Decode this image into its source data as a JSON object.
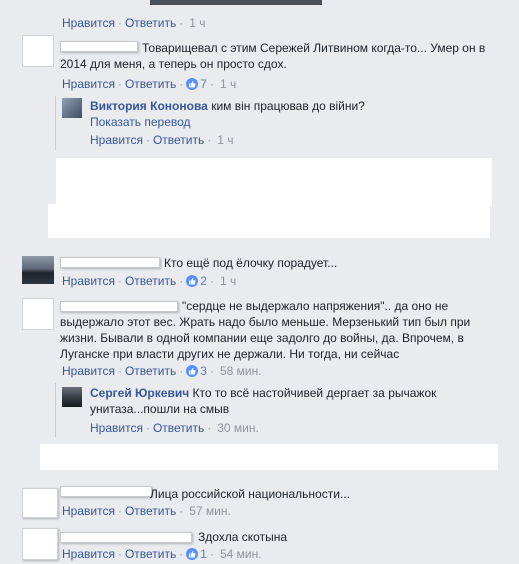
{
  "colors": {
    "page_bg": "#e9ebee",
    "link": "#365899",
    "action": "#5f7fb3",
    "meta": "#90949c",
    "like_badge": "#5890ff"
  },
  "labels": {
    "like": "Нравится",
    "reply": "Ответить",
    "sep": "·",
    "show_translation": "Показать перевод"
  },
  "comments": [
    {
      "id": "c0",
      "time": "1 ч"
    },
    {
      "id": "c1",
      "text": "Товарищевал с этим Сережей Литвином когда-то... Умер он в 2014 для меня, а теперь он просто сдох.",
      "likes": "7",
      "time": "1 ч",
      "reply": {
        "author": "Виктория Кононова",
        "text": "ким вiн працював до вiйни?",
        "time": "1 ч"
      }
    },
    {
      "id": "c2",
      "text": "Кто ещё под ёлочку порадует...",
      "likes": "2",
      "time": "1 ч"
    },
    {
      "id": "c3",
      "text": "\"сердце не выдержало напряжения\".. да оно не выдержало этот вес. Жрать надо было меньше. Мерзенький тип был при жизни. Бывали в одной компании еще задолго до войны, да. Впрочем, в Луганске при власти других не держали. Ни тогда, ни сейчас",
      "likes": "3",
      "time": "58 мин.",
      "reply": {
        "author": "Сергей Юркевич",
        "text": "Кто то всё настойчивей дергает за рычажок унитаза...пошли на смыв",
        "time": "30 мин."
      }
    },
    {
      "id": "c4",
      "text": "Лица российской национальности...",
      "time": "57 мин."
    },
    {
      "id": "c5",
      "text": "Здохла скотына",
      "likes": "1",
      "time": "54 мин."
    }
  ],
  "icons": {
    "like": "thumbs-up-icon"
  }
}
